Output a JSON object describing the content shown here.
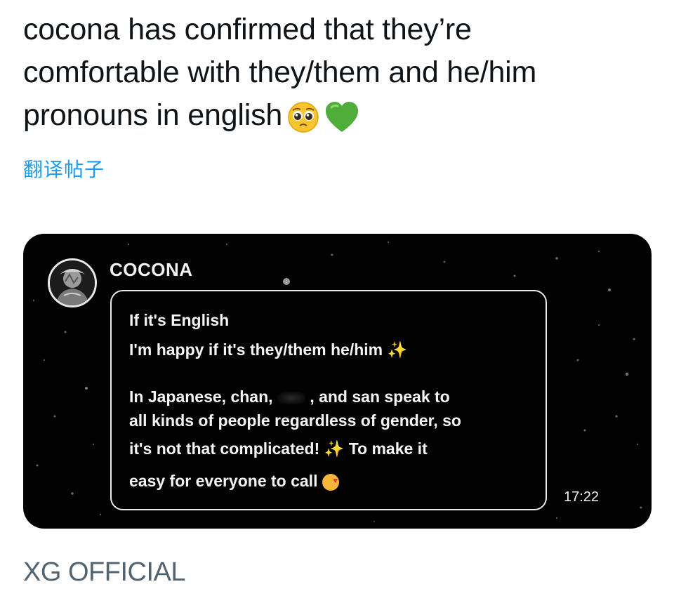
{
  "tweet": {
    "lines": [
      "cocona has confirmed that they’re",
      "comfortable with they/them and he/him",
      "pronouns in english"
    ],
    "emojis": [
      "pleading-face",
      "green-heart"
    ],
    "translate_label": "翻译帖子"
  },
  "chat": {
    "sender": "COCONA",
    "messages": [
      "If it's English",
      "I'm happy if it's they/them he/him",
      "In Japanese, chan,",
      ", and san speak to",
      "all kinds of people regardless of gender, so",
      "it's not that complicated!",
      "To make it",
      "easy for everyone to call"
    ],
    "time": "17:22"
  },
  "source": "XG OFFICIAL"
}
